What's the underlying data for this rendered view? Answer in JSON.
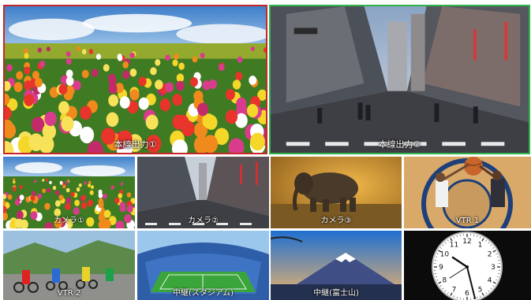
{
  "colors": {
    "program_tally": "#c62828",
    "preview_tally": "#2fb34a",
    "label_text": "#ffffff",
    "background": "#ffffff"
  },
  "tiles": {
    "program_out_1": {
      "label": "本線出力①",
      "icon": "tulip-field-image"
    },
    "program_out_2": {
      "label": "本線出力②",
      "icon": "city-street-image"
    },
    "camera_1": {
      "label": "カメラ①",
      "icon": "tulip-field-image"
    },
    "camera_2": {
      "label": "カメラ②",
      "icon": "city-street-image"
    },
    "camera_3": {
      "label": "カメラ③",
      "icon": "elephant-image"
    },
    "vtr_1": {
      "label": "VTR 1",
      "icon": "basketball-image"
    },
    "vtr_2": {
      "label": "VTR 2",
      "icon": "cycling-race-image"
    },
    "relay_stadium": {
      "label": "中継(スタジアム)",
      "icon": "stadium-image"
    },
    "relay_fuji": {
      "label": "中継(富士山)",
      "icon": "mount-fuji-image"
    },
    "clock": {
      "icon": "analog-clock-icon",
      "numerals": [
        "12",
        "1",
        "2",
        "3",
        "4",
        "5",
        "6",
        "7",
        "8",
        "9",
        "10",
        "11"
      ]
    }
  }
}
